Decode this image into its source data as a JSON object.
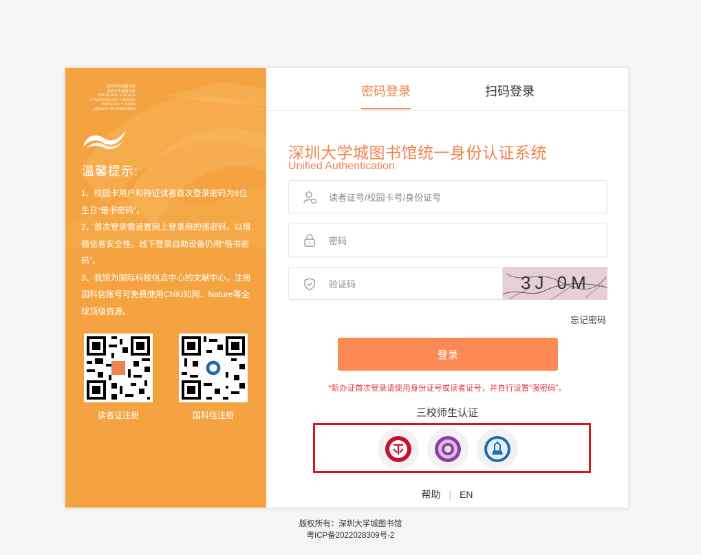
{
  "brand": {
    "logo_lines": [
      "深圳市科技图书馆",
      "深圳大学城图书馆",
      "SHENZHEN SCIENCE",
      "& TECHNOLOGY LIBRARY",
      "UNIVERSITY TOWN",
      "LIBRARY OF SHENZHEN"
    ]
  },
  "tips": {
    "title": "温馨提示:",
    "items": [
      "1、校园卡用户和持证读者首次登录密码为8位生日“借书密码”。",
      "2、首次登录需设置网上登录用的强密码，以增强信息安全性。线下登录自助设备仍用“借书密码”。",
      "3、我馆为国际科技信息中心的文献中心，注册国科信账号可免费使用CNKI知网、Nature等全球顶级资源。"
    ]
  },
  "qr_codes": [
    {
      "label": "读者证注册"
    },
    {
      "label": "国科信注册"
    }
  ],
  "tabs": [
    {
      "label": "密码登录",
      "active": true
    },
    {
      "label": "扫码登录",
      "active": false
    }
  ],
  "form": {
    "title": "深圳大学城图书馆统一身份认证系统",
    "subtitle": "Unified Authentication",
    "username_placeholder": "读者证号/校园卡号/身份证号",
    "password_placeholder": "密码",
    "captcha_placeholder": "验证码",
    "captcha_text": "3J 0M",
    "forgot_label": "忘记密码",
    "login_label": "登录",
    "notice": "*新办证首次登录请使用身份证号或读者证号，并自行设置“强密码”。"
  },
  "sso": {
    "title": "三校师生认证",
    "schools": [
      {
        "icon": "pku-emblem-icon",
        "color": "#c8102e"
      },
      {
        "icon": "thu-emblem-icon",
        "color": "#8b3fa3"
      },
      {
        "icon": "hit-emblem-icon",
        "color": "#1d6bb0"
      }
    ]
  },
  "footer": {
    "help_label": "帮助",
    "separator": "|",
    "lang_label": "EN",
    "copyright": "版权所有：深圳大学城图书馆",
    "icp": "粤ICP备2022028309号-2"
  },
  "colors": {
    "accent": "#f0834f",
    "button": "#fd8a55",
    "panel": "#f4a340",
    "notice": "#e4393c",
    "highlight_box": "#d9161f"
  }
}
